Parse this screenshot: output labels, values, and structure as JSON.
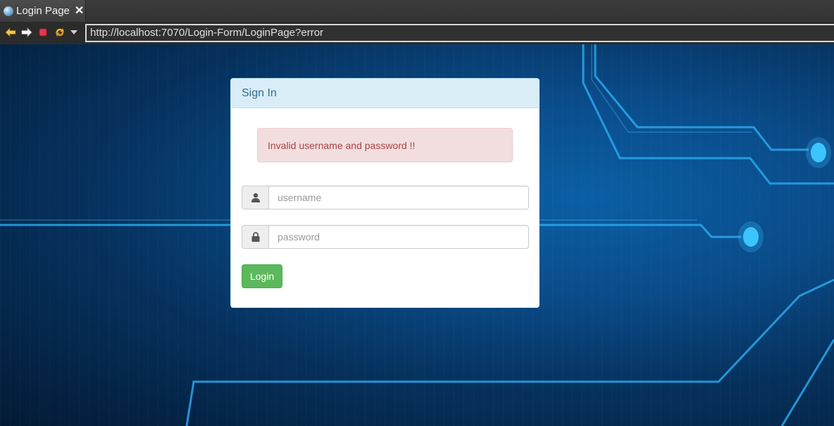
{
  "browser": {
    "tab": {
      "title": "Login Page",
      "close_glyph": "✕",
      "icon": "globe-icon"
    },
    "nav": {
      "back_icon": "back-arrow-icon",
      "forward_icon": "forward-arrow-icon",
      "stop_icon": "stop-icon",
      "refresh_icon": "refresh-icon",
      "dropdown_icon": "chevron-down-icon",
      "url": "http://localhost:7070/Login-Form/LoginPage?error"
    }
  },
  "login": {
    "heading": "Sign In",
    "error_message": "Invalid username and password !!",
    "username": {
      "placeholder": "username",
      "value": "",
      "icon": "user-icon"
    },
    "password": {
      "placeholder": "password",
      "value": "",
      "icon": "lock-icon"
    },
    "submit_label": "Login"
  },
  "colors": {
    "panel_heading_bg": "#d9edf7",
    "panel_heading_text": "#31708f",
    "alert_bg": "#f2dede",
    "alert_text": "#a94442",
    "login_button": "#5cb85c",
    "background_accent": "#1fa3e8"
  }
}
